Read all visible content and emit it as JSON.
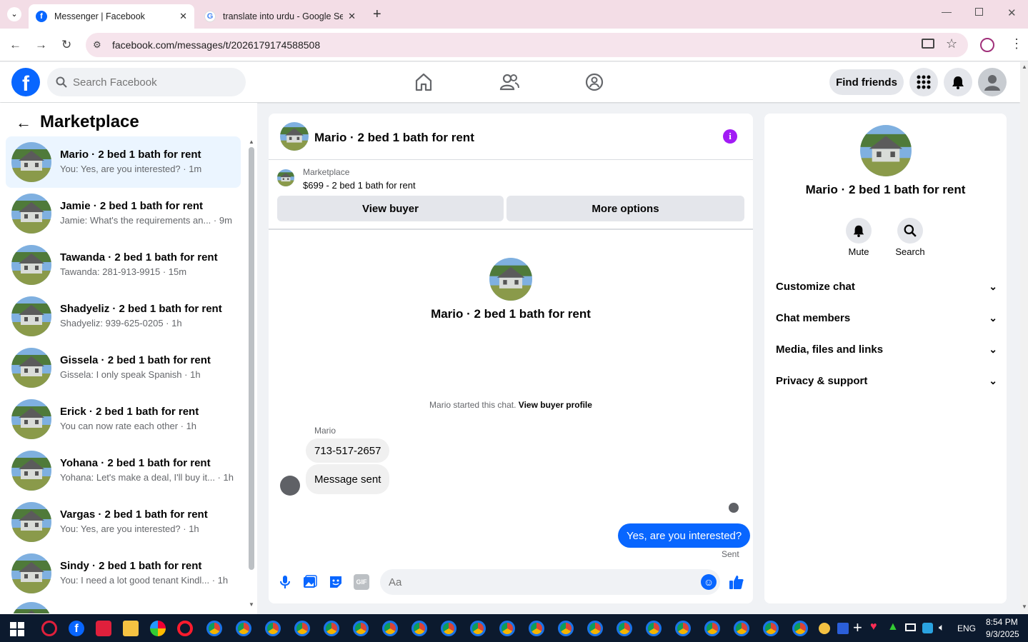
{
  "browser": {
    "tabs": [
      {
        "title": "Messenger | Facebook",
        "favicon": "facebook-icon"
      },
      {
        "title": "translate into urdu - Google Se",
        "favicon": "google-icon"
      }
    ],
    "url": "facebook.com/messages/t/2026179174588508"
  },
  "fb": {
    "search_placeholder": "Search Facebook",
    "find_friends": "Find friends",
    "brand_color": "#0866ff"
  },
  "left": {
    "title": "Marketplace",
    "conversations": [
      {
        "name": "Mario · 2 bed 1 bath for rent",
        "preview": "You: Yes, are you interested? · 1m",
        "selected": true
      },
      {
        "name": "Jamie · 2 bed 1 bath for rent",
        "preview": "Jamie: What's the requirements an... · 9m"
      },
      {
        "name": "Tawanda · 2 bed 1 bath for rent",
        "preview": "Tawanda: 281-913-9915 · 15m"
      },
      {
        "name": "Shadyeliz · 2 bed 1 bath for rent",
        "preview": "Shadyeliz: 939-625-0205 · 1h"
      },
      {
        "name": "Gissela · 2 bed 1 bath for rent",
        "preview": "Gissela: I only speak Spanish · 1h"
      },
      {
        "name": "Erick · 2 bed 1 bath for rent",
        "preview": "You can now rate each other · 1h"
      },
      {
        "name": "Yohana · 2 bed 1 bath for rent",
        "preview": "Yohana: Let's make a deal, I'll buy it... · 1h"
      },
      {
        "name": "Vargas · 2 bed 1 bath for rent",
        "preview": "You: Yes, are you interested? · 1h"
      },
      {
        "name": "Sindy · 2 bed 1 bath for rent",
        "preview": "You: I need a lot good tenant Kindl... · 1h"
      }
    ]
  },
  "chat": {
    "header_title": "Mario · 2 bed 1 bath for rent",
    "listing_source": "Marketplace",
    "listing_title": "$699 - 2 bed 1 bath for rent",
    "view_buyer": "View buyer",
    "more_options": "More options",
    "intro_name": "Mario · 2 bed 1 bath for rent",
    "started_text": "Mario started this chat.",
    "view_buyer_profile": "View buyer profile",
    "sender_label": "Mario",
    "messages_in": [
      "713-517-2657",
      "Message sent"
    ],
    "message_out": "Yes, are you interested?",
    "status": "Sent",
    "input_placeholder": "Aa"
  },
  "right": {
    "name": "Mario · 2 bed 1 bath for rent",
    "mute": "Mute",
    "search": "Search",
    "sections": [
      "Customize chat",
      "Chat members",
      "Media, files and links",
      "Privacy & support"
    ]
  },
  "taskbar": {
    "time": "8:54 PM",
    "date": "9/3/2025",
    "lang": "ENG"
  }
}
